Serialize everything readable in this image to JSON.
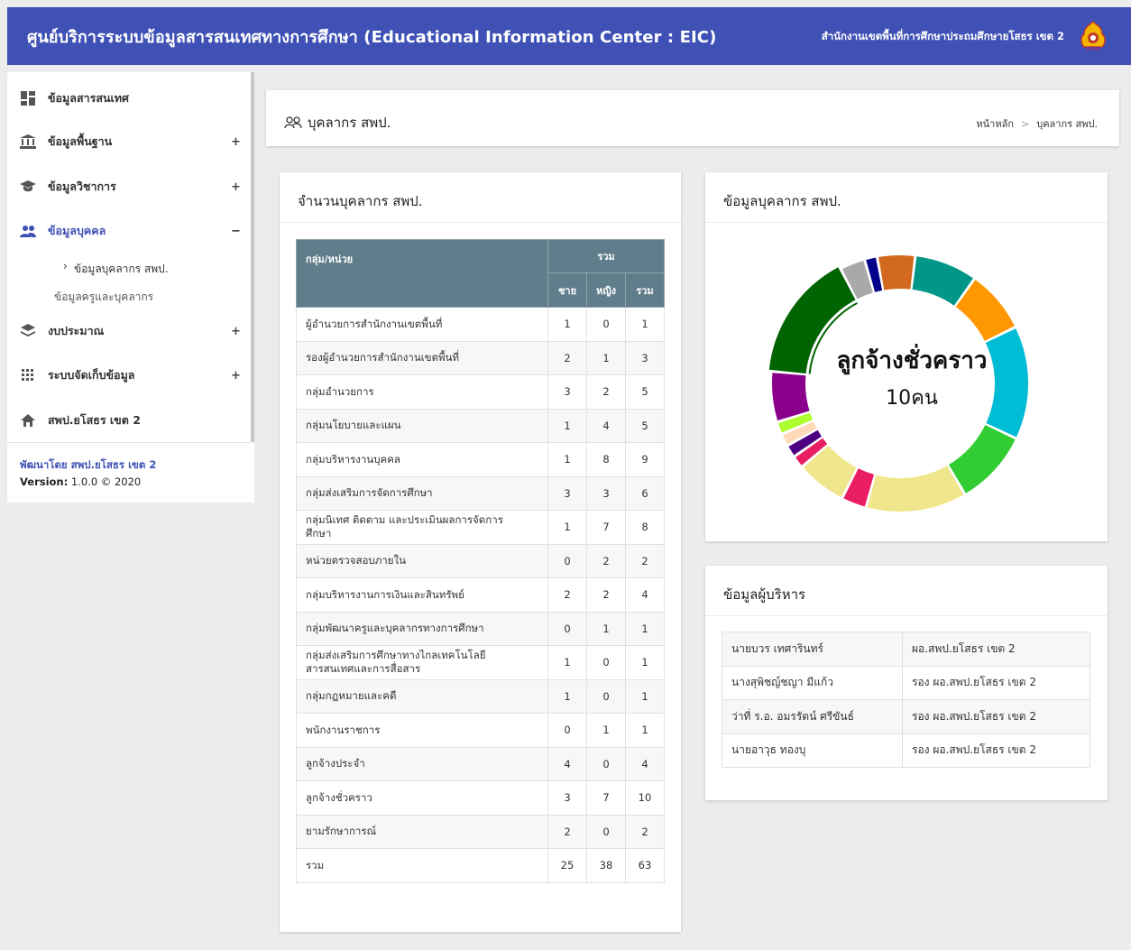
{
  "header": {
    "title": "ศูนย์บริการระบบข้อมูลสารสนเทศทางการศึกษา (Educational Information Center : EIC)",
    "office": "สำนักงานเขตพื้นที่การศึกษาประถมศึกษายโสธร เขต 2"
  },
  "sidebar": {
    "items": [
      {
        "label": "ข้อมูลสารสนเทศ",
        "icon": "dashboard-icon",
        "toggle": ""
      },
      {
        "label": "ข้อมูลพื้นฐาน",
        "icon": "bank-icon",
        "toggle": "+"
      },
      {
        "label": "ข้อมูลวิชาการ",
        "icon": "graduation-cap-icon",
        "toggle": "+"
      },
      {
        "label": "ข้อมูลบุคคล",
        "icon": "people-icon",
        "toggle": "−"
      },
      {
        "label": "งบประมาณ",
        "icon": "layers-icon",
        "toggle": "+"
      },
      {
        "label": "ระบบจัดเก็บข้อมูล",
        "icon": "grid-icon",
        "toggle": "+"
      },
      {
        "label": "สพป.ยโสธร เขต 2",
        "icon": "home-icon",
        "toggle": ""
      }
    ],
    "subitems": [
      "ข้อมูลบุคลากร สพป.",
      "ข้อมูลครูและบุคลากร"
    ],
    "credit": "พัฒนาโดย สพป.ยโสธร เขต 2",
    "version_label": "Version:",
    "version_value": "1.0.0 © 2020"
  },
  "page": {
    "title": "บุคลากร สพป.",
    "breadcrumb": [
      "หน้าหลัก",
      ">",
      "บุคลากร สพป."
    ]
  },
  "staff_table": {
    "title": "จำนวนบุคลากร สพป.",
    "headers": {
      "group": "กลุ่ม/หน่วย",
      "total": "รวม",
      "male": "ชาย",
      "female": "หญิง",
      "sum": "รวม"
    },
    "rows": [
      {
        "name": "ผู้อำนวยการสำนักงานเขตพื้นที่",
        "male": "1",
        "female": "0",
        "total": "1"
      },
      {
        "name": "รองผู้อำนวยการสำนักงานเขตพื้นที่",
        "male": "2",
        "female": "1",
        "total": "3"
      },
      {
        "name": "กลุ่มอำนวยการ",
        "male": "3",
        "female": "2",
        "total": "5"
      },
      {
        "name": "กลุ่มนโยบายและแผน",
        "male": "1",
        "female": "4",
        "total": "5"
      },
      {
        "name": "กลุ่มบริหารงานบุคคล",
        "male": "1",
        "female": "8",
        "total": "9"
      },
      {
        "name": "กลุ่มส่งเสริมการจัดการศึกษา",
        "male": "3",
        "female": "3",
        "total": "6"
      },
      {
        "name": "กลุ่มนิเทศ ติดตาม และประเมินผลการจัดการศึกษา",
        "male": "1",
        "female": "7",
        "total": "8"
      },
      {
        "name": "หน่วยตรวจสอบภายใน",
        "male": "0",
        "female": "2",
        "total": "2"
      },
      {
        "name": "กลุ่มบริหารงานการเงินและสินทรัพย์",
        "male": "2",
        "female": "2",
        "total": "4"
      },
      {
        "name": "กลุ่มพัฒนาครูและบุคลากรทางการศึกษา",
        "male": "0",
        "female": "1",
        "total": "1"
      },
      {
        "name": "กลุ่มส่งเสริมการศึกษาทางไกลเทคโนโลยีสารสนเทศและการสื่อสาร",
        "male": "1",
        "female": "0",
        "total": "1"
      },
      {
        "name": "กลุ่มกฎหมายและคดี",
        "male": "1",
        "female": "0",
        "total": "1"
      },
      {
        "name": "พนักงานราชการ",
        "male": "0",
        "female": "1",
        "total": "1"
      },
      {
        "name": "ลูกจ้างประจำ",
        "male": "4",
        "female": "0",
        "total": "4"
      },
      {
        "name": "ลูกจ้างชั่วคราว",
        "male": "3",
        "female": "7",
        "total": "10"
      },
      {
        "name": "ยามรักษาการณ์",
        "male": "2",
        "female": "0",
        "total": "2"
      },
      {
        "name": "รวม",
        "male": "25",
        "female": "38",
        "total": "63"
      }
    ]
  },
  "donut": {
    "title": "ข้อมูลบุคลากร สพป.",
    "center_label": "ลูกจ้างชั่วคราว",
    "center_value": "10คน"
  },
  "chart_data": {
    "type": "pie",
    "title": "ข้อมูลบุคลากร สพป.",
    "categories": [
      "ผู้อำนวยการสำนักงานเขตพื้นที่",
      "รองผู้อำนวยการสำนักงานเขตพื้นที่",
      "กลุ่มอำนวยการ",
      "กลุ่มนโยบายและแผน",
      "กลุ่มบริหารงานบุคคล",
      "กลุ่มส่งเสริมการจัดการศึกษา",
      "กลุ่มนิเทศ ติดตาม และประเมินผลการจัดการศึกษา",
      "หน่วยตรวจสอบภายใน",
      "กลุ่มบริหารงานการเงินและสินทรัพย์",
      "กลุ่มพัฒนาครูและบุคลากรทางการศึกษา",
      "กลุ่มส่งเสริมการศึกษาทางไกลเทคโนโลยีสารสนเทศและการสื่อสาร",
      "กลุ่มกฎหมายและคดี",
      "พนักงานราชการ",
      "ลูกจ้างประจำ",
      "ลูกจ้างชั่วคราว",
      "ยามรักษาการณ์"
    ],
    "values": [
      1,
      3,
      5,
      5,
      9,
      6,
      8,
      2,
      4,
      1,
      1,
      1,
      1,
      4,
      10,
      2
    ],
    "colors": [
      "#00008b",
      "#d2691e",
      "#009688",
      "#ff9800",
      "#00bcd4",
      "#32cd32",
      "#f0e68c",
      "#e91e63",
      "#f0e68c",
      "#e91e63",
      "#4b0082",
      "#ffdab9",
      "#adff2f",
      "#8b008b",
      "#006400",
      "#a9a9a9"
    ],
    "highlighted": "ลูกจ้างชั่วคราว",
    "legend": "none"
  },
  "executives": {
    "title": "ข้อมูลผู้บริหาร",
    "rows": [
      {
        "name": "นายบวร เทศารินทร์",
        "position": "ผอ.สพป.ยโสธร เขต 2"
      },
      {
        "name": "นางสุพิชญ์ชญา มีแก้ว",
        "position": "รอง ผอ.สพป.ยโสธร เขต 2"
      },
      {
        "name": "ว่าที่ ร.อ. อมรรัตน์ ศรีขันธ์",
        "position": "รอง ผอ.สพป.ยโสธร เขต 2"
      },
      {
        "name": "นายอาวุธ ทองบุ",
        "position": "รอง ผอ.สพป.ยโสธร เขต 2"
      }
    ]
  }
}
